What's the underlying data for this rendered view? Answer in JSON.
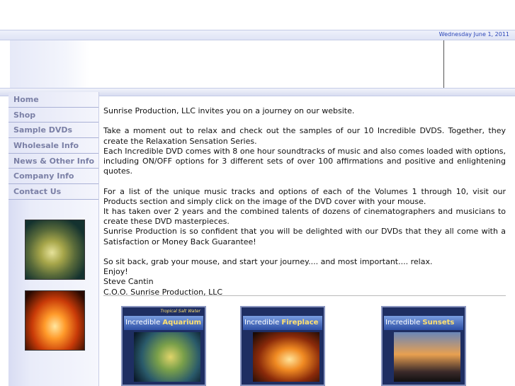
{
  "header": {
    "date": "Wednesday June 1, 2011"
  },
  "nav": [
    {
      "label": "Home"
    },
    {
      "label": "Shop"
    },
    {
      "label": "Sample DVDs"
    },
    {
      "label": "Wholesale Info"
    },
    {
      "label": "News & Other Info"
    },
    {
      "label": "Company Info"
    },
    {
      "label": "Contact Us"
    }
  ],
  "content": {
    "p1": "Sunrise Production, LLC invites you on a journey on our website.",
    "p2": "Take a moment out to relax and check out the samples of our 10 Incredible DVDS. Together, they create the Relaxation Sensation Series.",
    "p3": "Each Incredible DVD comes with 8 one hour soundtracks of music and also comes loaded with options, including ON/OFF options for 3 different sets of over 100 affirmations and positive and enlightening quotes.",
    "p4": "For a list of the unique music tracks and options of each of the Volumes 1 through 10, visit our Products section and simply click on the image of the DVD cover with your mouse.",
    "p5": "It has taken over 2 years and the combined talents of dozens of cinematographers and musicians to create these DVD masterpieces.",
    "p6": "Sunrise Production is so confident that you will be delighted with our DVDs that they all come with a Satisfaction or Money Back Guarantee!",
    "p7": "So sit back, grab your mouse, and start your journey.... and most important.... relax.",
    "p8": "Enjoy!",
    "p9": "Steve Cantin",
    "p10": "C.O.O. Sunrise Production, LLC"
  },
  "dvds": [
    {
      "word": "Incredible",
      "name": "Aquarium",
      "tag": "Tropical Salt Water"
    },
    {
      "word": "Incredible",
      "name": "Fireplace"
    },
    {
      "word": "Incredible",
      "name": "Sunsets"
    }
  ]
}
